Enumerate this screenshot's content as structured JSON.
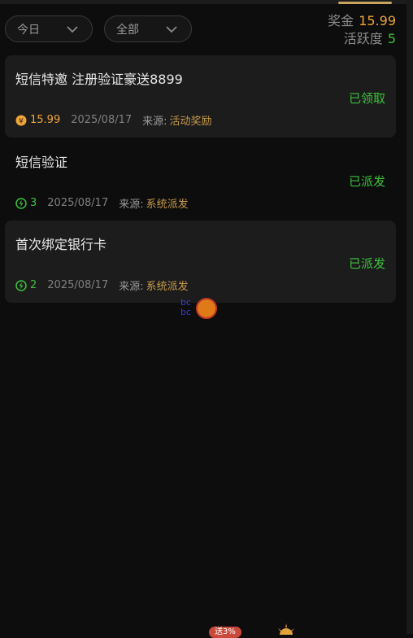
{
  "filters": {
    "date_value": "今日",
    "type_value": "全部"
  },
  "stats": {
    "bonus_label": "奖金",
    "bonus_value": "15.99",
    "activity_label": "活跃度",
    "activity_value": "5"
  },
  "records": [
    {
      "title": "短信特邀 注册验证豪送8899",
      "status": "已领取",
      "amount": "15.99",
      "amount_icon": "coin-icon",
      "date": "2025/08/17",
      "source_label": "来源:",
      "source": "活动奖励"
    },
    {
      "title": "短信验证",
      "status": "已派发",
      "amount": "3",
      "amount_icon": "bolt-icon",
      "date": "2025/08/17",
      "source_label": "来源:",
      "source": "系统派发"
    },
    {
      "title": "首次绑定银行卡",
      "status": "已派发",
      "amount": "2",
      "amount_icon": "bolt-icon",
      "date": "2025/08/17",
      "source_label": "来源:",
      "source": "系统派发"
    }
  ],
  "watermark": {
    "line1": "bc",
    "line2": "bc"
  },
  "footer": {
    "promo_badge": "送3%"
  },
  "colors": {
    "gold": "#f0a53a",
    "green": "#3cc23c",
    "source": "#c99a4a",
    "card_bg": "#1c1c1c"
  }
}
